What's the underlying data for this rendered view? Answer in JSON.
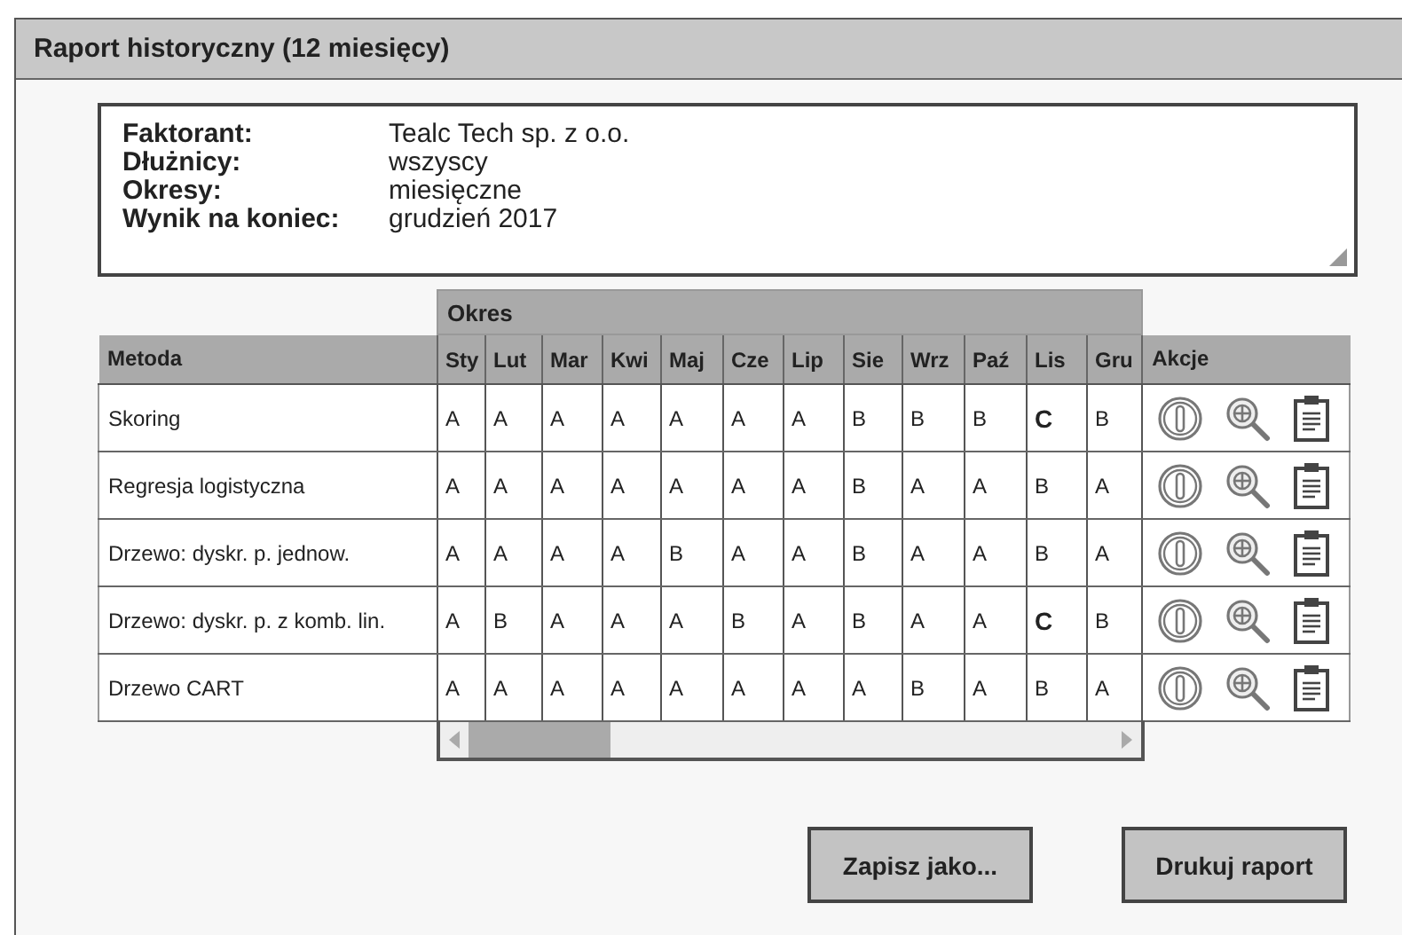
{
  "window": {
    "title": "Raport historyczny (12 miesięcy)"
  },
  "info": [
    {
      "label": "Faktorant:",
      "value": "Tealc Tech sp. z o.o."
    },
    {
      "label": "Dłużnicy:",
      "value": "wszyscy"
    },
    {
      "label": "Okresy:",
      "value": "miesięczne"
    },
    {
      "label": "Wynik na koniec:",
      "value": "grudzień 2017"
    }
  ],
  "table": {
    "group_header": "Okres",
    "method_header": "Metoda",
    "actions_header": "Akcje",
    "months": [
      "Sty",
      "Lut",
      "Mar",
      "Kwi",
      "Maj",
      "Cze",
      "Lip",
      "Sie",
      "Wrz",
      "Paź",
      "Lis",
      "Gru"
    ],
    "rows": [
      {
        "method": "Skoring",
        "cells": [
          {
            "text": "A",
            "bold": false
          },
          {
            "text": "A",
            "bold": false
          },
          {
            "text": "A",
            "bold": false
          },
          {
            "text": "A",
            "bold": false
          },
          {
            "text": "A",
            "bold": false
          },
          {
            "text": "A",
            "bold": false
          },
          {
            "text": "A",
            "bold": false
          },
          {
            "text": "B",
            "bold": false
          },
          {
            "text": "B",
            "bold": false
          },
          {
            "text": "B",
            "bold": false
          },
          {
            "text": "C",
            "bold": true
          },
          {
            "text": "B",
            "bold": false
          }
        ]
      },
      {
        "method": "Regresja logistyczna",
        "cells": [
          {
            "text": "A",
            "bold": false
          },
          {
            "text": "A",
            "bold": false
          },
          {
            "text": "A",
            "bold": false
          },
          {
            "text": "A",
            "bold": false
          },
          {
            "text": "A",
            "bold": false
          },
          {
            "text": "A",
            "bold": false
          },
          {
            "text": "A",
            "bold": false
          },
          {
            "text": "B",
            "bold": false
          },
          {
            "text": "A",
            "bold": false
          },
          {
            "text": "A",
            "bold": false
          },
          {
            "text": "B",
            "bold": false
          },
          {
            "text": "A",
            "bold": false
          }
        ]
      },
      {
        "method": "Drzewo: dyskr. p. jednow.",
        "cells": [
          {
            "text": "A",
            "bold": false
          },
          {
            "text": "A",
            "bold": false
          },
          {
            "text": "A",
            "bold": false
          },
          {
            "text": "A",
            "bold": false
          },
          {
            "text": "B",
            "bold": false
          },
          {
            "text": "A",
            "bold": false
          },
          {
            "text": "A",
            "bold": false
          },
          {
            "text": "B",
            "bold": false
          },
          {
            "text": "A",
            "bold": false
          },
          {
            "text": "A",
            "bold": false
          },
          {
            "text": "B",
            "bold": false
          },
          {
            "text": "A",
            "bold": false
          }
        ]
      },
      {
        "method": "Drzewo: dyskr. p. z komb. lin.",
        "cells": [
          {
            "text": "A",
            "bold": false
          },
          {
            "text": "B",
            "bold": false
          },
          {
            "text": "A",
            "bold": false
          },
          {
            "text": "A",
            "bold": false
          },
          {
            "text": "A",
            "bold": false
          },
          {
            "text": "B",
            "bold": false
          },
          {
            "text": "A",
            "bold": false
          },
          {
            "text": "B",
            "bold": false
          },
          {
            "text": "A",
            "bold": false
          },
          {
            "text": "A",
            "bold": false
          },
          {
            "text": "C",
            "bold": true
          },
          {
            "text": "B",
            "bold": false
          }
        ]
      },
      {
        "method": "Drzewo CART",
        "cells": [
          {
            "text": "A",
            "bold": false
          },
          {
            "text": "A",
            "bold": false
          },
          {
            "text": "A",
            "bold": false
          },
          {
            "text": "A",
            "bold": false
          },
          {
            "text": "A",
            "bold": false
          },
          {
            "text": "A",
            "bold": false
          },
          {
            "text": "A",
            "bold": false
          },
          {
            "text": "A",
            "bold": false
          },
          {
            "text": "B",
            "bold": false
          },
          {
            "text": "A",
            "bold": false
          },
          {
            "text": "B",
            "bold": false
          },
          {
            "text": "A",
            "bold": false
          }
        ]
      }
    ]
  },
  "buttons": [
    "Zapisz jako...",
    "Drukuj raport"
  ]
}
